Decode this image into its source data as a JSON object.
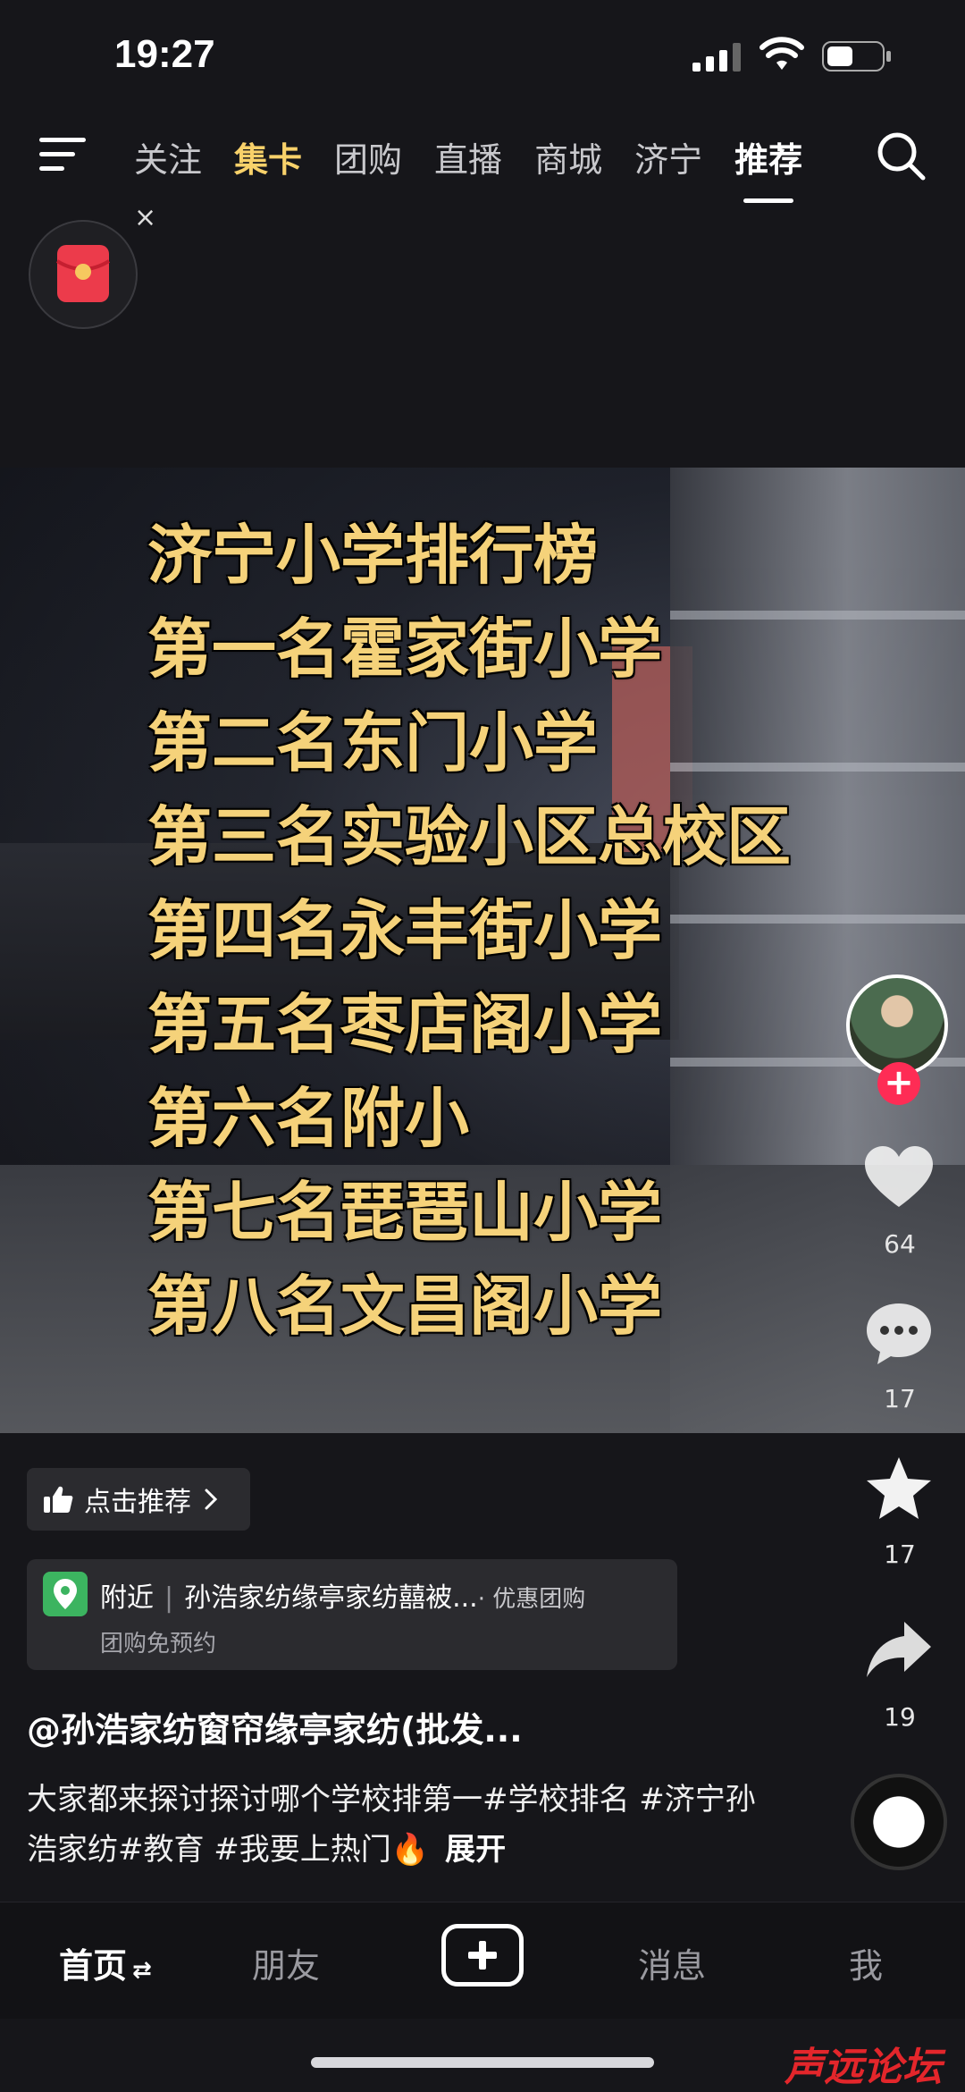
{
  "status_bar": {
    "time": "19:27"
  },
  "nav": {
    "tabs": [
      {
        "label": "关注",
        "style": "normal"
      },
      {
        "label": "集卡",
        "style": "gold"
      },
      {
        "label": "团购",
        "style": "normal"
      },
      {
        "label": "直播",
        "style": "normal"
      },
      {
        "label": "商城",
        "style": "normal"
      },
      {
        "label": "济宁",
        "style": "normal"
      },
      {
        "label": "推荐",
        "style": "active"
      }
    ]
  },
  "float": {
    "close": "×"
  },
  "video": {
    "lines": [
      "济宁小学排行榜",
      "第一名霍家街小学",
      "第二名东门小学",
      "第三名实验小区总校区",
      "第四名永丰街小学",
      "第五名枣店阁小学",
      "第六名附小",
      "第七名琵琶山小学",
      "第八名文昌阁小学"
    ]
  },
  "rail": {
    "follow": "+",
    "likes": "64",
    "comments": "17",
    "favorites": "17",
    "shares": "19"
  },
  "info": {
    "recommend": "点击推荐",
    "location_label": "附近",
    "location_name": "孙浩家纺缘亭家纺囍被...",
    "location_tag": "· 优惠团购",
    "location_sub": "团购免预约",
    "author": "@孙浩家纺窗帘缘亭家纺(批发...",
    "description": "大家都来探讨探讨哪个学校排第一#学校排名 #济宁孙浩家纺#教育 #我要上热门🔥",
    "expand": "展开"
  },
  "bottom_nav": {
    "home": "首页",
    "friends": "朋友",
    "messages": "消息",
    "me": "我"
  },
  "watermark": "声远论坛",
  "colors": {
    "gold_tab": "#f8d16a",
    "rank_text": "#f5d27a",
    "follow_red": "#fe2c55",
    "location_green": "#3cb460"
  }
}
